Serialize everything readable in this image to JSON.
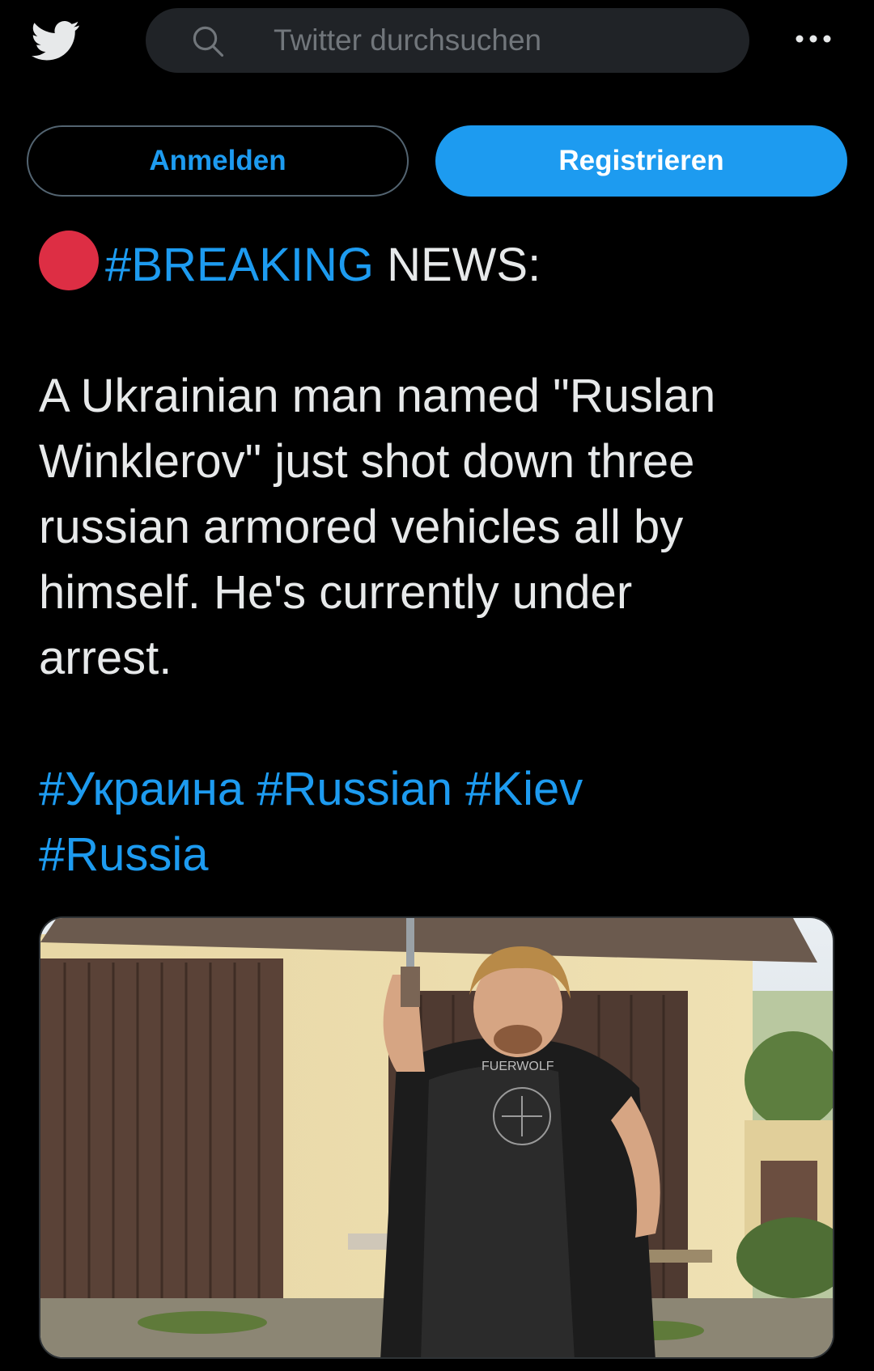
{
  "header": {
    "logo_icon": "twitter-bird-icon",
    "search": {
      "placeholder": "Twitter durchsuchen",
      "icon": "search-icon"
    },
    "more_icon": "more-dots-icon"
  },
  "auth": {
    "login_label": "Anmelden",
    "register_label": "Registrieren"
  },
  "tweet": {
    "breaking_emoji": "red-circle-icon",
    "breaking_tag": "#BREAKING",
    "breaking_rest": " NEWS:",
    "body_lines": [
      "A Ukrainian man named \"Ruslan",
      "Winklerov\" just shot down three",
      "russian armored vehicles all by",
      "himself. He's currently under",
      "arrest."
    ],
    "hashtags_line1": [
      "#Украина",
      "#Russian",
      "#Kiev"
    ],
    "hashtags_line2": [
      "#Russia"
    ]
  },
  "colors": {
    "background": "#000000",
    "accent": "#1d9bf0",
    "text": "#e7e9ea",
    "breaking_dot": "#dd2e44"
  }
}
